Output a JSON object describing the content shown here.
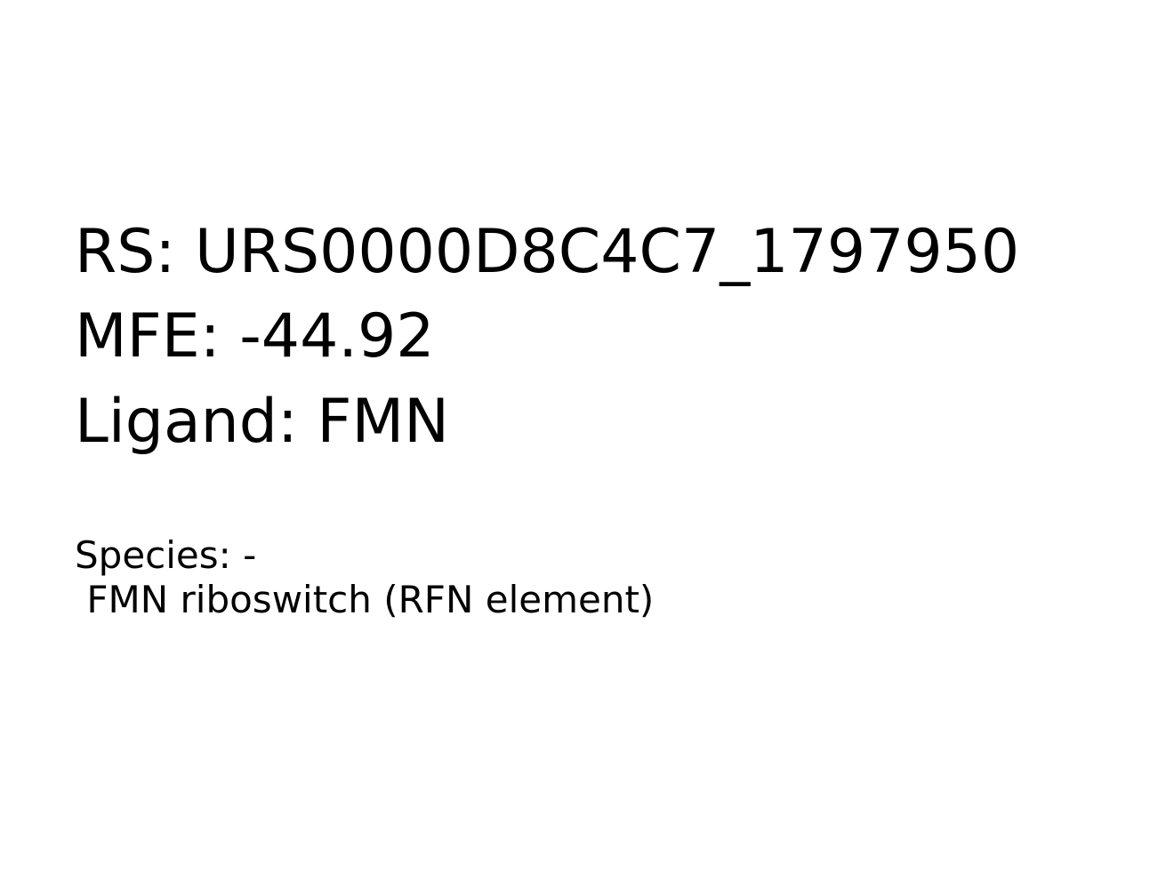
{
  "header": {
    "rs_line": "RS: URS0000D8C4C7_1797950",
    "mfe_line": "MFE: -44.92",
    "ligand_line": "Ligand: FMN"
  },
  "details": {
    "species_line": "Species: -",
    "family_line": " FMN riboswitch (RFN element)"
  }
}
